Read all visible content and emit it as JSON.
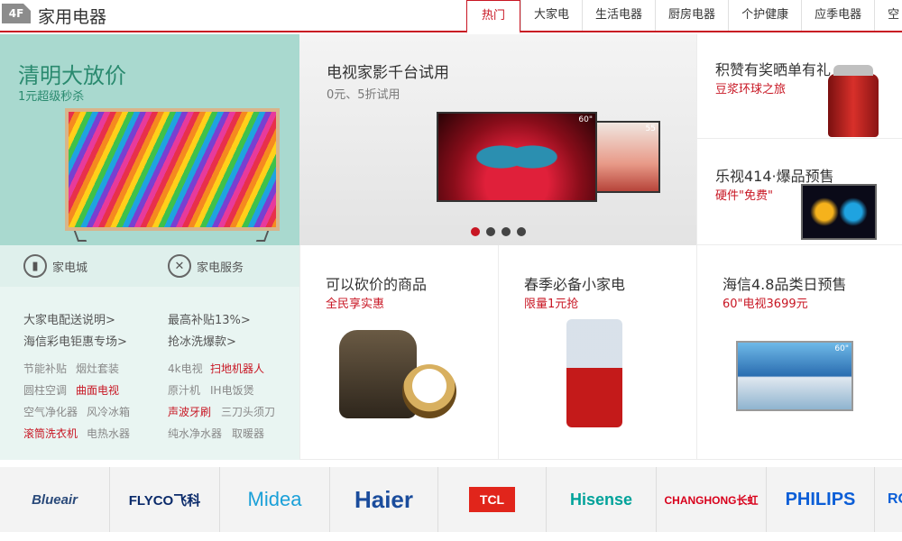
{
  "header": {
    "floor_badge": "4F",
    "floor_title": "家用电器",
    "tabs": [
      "热门",
      "大家电",
      "生活电器",
      "厨房电器",
      "个护健康",
      "应季电器",
      "空"
    ]
  },
  "hero": {
    "title": "清明大放价",
    "subtitle": "1元超级秒杀"
  },
  "services": {
    "mall_label": "家电城",
    "service_label": "家电服务"
  },
  "links": {
    "primary": [
      "大家电配送说明>",
      "最高补贴13%>",
      "海信彩电钜惠专场>",
      "抢冰洗爆款>"
    ],
    "tags": [
      [
        "节能补贴",
        "烟灶套装",
        "4k电视",
        "扫地机器人"
      ],
      [
        "圆柱空调",
        "曲面电视",
        "原汁机",
        "IH电饭煲"
      ],
      [
        "空气净化器",
        "风冷冰箱",
        "声波牙刷",
        "三刀头须刀"
      ],
      [
        "滚筒洗衣机",
        "电热水器",
        "纯水净水器",
        "取暖器"
      ]
    ]
  },
  "tv_promo": {
    "title": "电视家影千台试用",
    "subtitle": "0元、5折试用",
    "big_tv_size": "60\"",
    "small_tv_size": "55"
  },
  "side_promos": [
    {
      "title": "积赞有奖晒单有礼",
      "subtitle": "豆浆环球之旅"
    },
    {
      "title": "乐视414·爆品预售",
      "subtitle": "硬件\"免费\""
    }
  ],
  "product_cells": [
    {
      "title": "可以砍价的商品",
      "subtitle": "全民享实惠"
    },
    {
      "title": "春季必备小家电",
      "subtitle": "限量1元抢"
    },
    {
      "title": "海信4.8品类日预售",
      "subtitle": "60\"电视3699元",
      "tv_size": "60\""
    }
  ],
  "brands": [
    "Blueair",
    "FLYCO飞科",
    "Midea",
    "Haier",
    "TCL",
    "Hisense",
    "CHANGHONG长虹",
    "PHILIPS",
    "RO"
  ],
  "colors": {
    "accent": "#c81623",
    "hero_bg": "#a9d9cf",
    "hero_text": "#2a8a6f",
    "midea_blue": "#1aa0d8",
    "haier_blue": "#1a4c9c",
    "tcl_red": "#e1251b",
    "hisense_green": "#00a29a",
    "changhong_red": "#d8001b",
    "philips_blue": "#0b5ed7"
  }
}
